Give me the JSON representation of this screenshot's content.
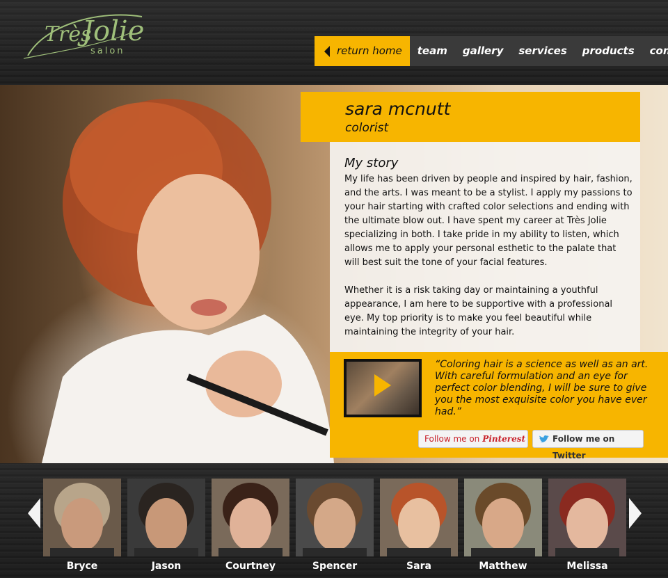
{
  "brand": {
    "logo_text_1": "Très",
    "logo_text_2": "Jolie",
    "logo_text_3": "salon",
    "accent_color": "#f7b500",
    "logo_color": "#9fbf7a"
  },
  "nav": {
    "items": [
      {
        "label": "return home",
        "icon": "left-triangle-icon"
      },
      {
        "label": "team"
      },
      {
        "label": "gallery"
      },
      {
        "label": "services"
      },
      {
        "label": "products"
      },
      {
        "label": "contact"
      }
    ]
  },
  "profile": {
    "name": "sara mcnutt",
    "role": "colorist",
    "story_title": "My story",
    "story_p1": "My life has been driven by people and inspired by hair, fashion, and the arts. I was meant to be a stylist. I apply my passions to your hair starting with crafted color selections and ending with the ultimate blow out. I have spent my career at Très Jolie specializing in both. I take pride in my ability to listen, which allows me to apply your personal esthetic to the palate that will best suit the tone of your facial features.",
    "story_p2": "Whether it is a risk taking day or maintaining a youthful appearance, I am here to be supportive with a professional eye. My top priority is to make you feel beautiful while maintaining the integrity of your hair.",
    "quote": "“Coloring hair is a science as well as an art. With careful formulation and an eye for perfect color blending, I will be sure to give you the most exquisite color you have ever had.”"
  },
  "social": {
    "pinterest_prefix": "Follow me on",
    "pinterest_brand": "Pinterest",
    "twitter_label": "Follow me on Twitter"
  },
  "team_strip": {
    "members": [
      {
        "name": "Bryce",
        "hair": "#b8a58a",
        "skin": "#c99a7c",
        "bg": "#6a5a4a"
      },
      {
        "name": "Jason",
        "hair": "#2a2420",
        "skin": "#c89878",
        "bg": "#3a3a3a"
      },
      {
        "name": "Courtney",
        "hair": "#3a2218",
        "skin": "#e0b298",
        "bg": "#7a6a5a"
      },
      {
        "name": "Spencer",
        "hair": "#6a4a30",
        "skin": "#d4a888",
        "bg": "#4a4a4a"
      },
      {
        "name": "Sara",
        "hair": "#b8542a",
        "skin": "#e8c0a0",
        "bg": "#7a6a5a"
      },
      {
        "name": "Matthew",
        "hair": "#6a4a2a",
        "skin": "#d8a888",
        "bg": "#8a8a7a"
      },
      {
        "name": "Melissa",
        "hair": "#8a2a20",
        "skin": "#e4b89e",
        "bg": "#5a4a4a"
      }
    ]
  }
}
